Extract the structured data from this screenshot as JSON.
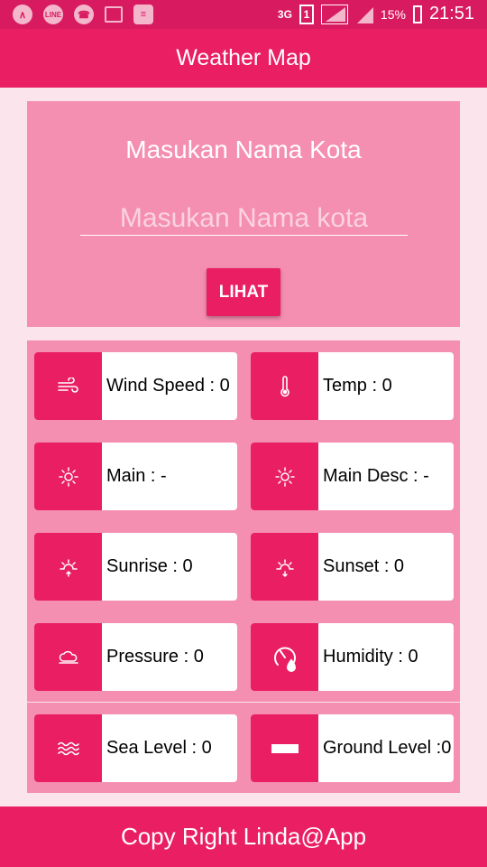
{
  "status_bar": {
    "network": "3G",
    "sim": "1",
    "battery": "15%",
    "time": "21:51",
    "icons": [
      "nav-icon",
      "line-icon",
      "whatsapp-icon",
      "gallery-icon",
      "wifi-icon"
    ]
  },
  "app_bar": {
    "title": "Weather Map"
  },
  "search": {
    "title": "Masukan Nama Kota",
    "placeholder": "Masukan Nama kota",
    "value": "",
    "button_label": "LIHAT"
  },
  "cards": {
    "wind_speed": {
      "label": "Wind Speed : 0",
      "icon": "wind-icon"
    },
    "temp": {
      "label": "Temp : 0",
      "icon": "thermometer-icon"
    },
    "main": {
      "label": "Main : -",
      "icon": "sun-icon"
    },
    "main_desc": {
      "label": "Main Desc : -",
      "icon": "sun-icon"
    },
    "sunrise": {
      "label": "Sunrise : 0",
      "icon": "sunrise-icon"
    },
    "sunset": {
      "label": "Sunset : 0",
      "icon": "sunset-icon"
    },
    "pressure": {
      "label": "Pressure : 0",
      "icon": "cloud-icon"
    },
    "humidity": {
      "label": "Humidity : 0",
      "icon": "humidity-gauge-icon"
    },
    "sea_level": {
      "label": "Sea Level : 0",
      "icon": "waves-icon"
    },
    "ground_level": {
      "label": "Ground Level :0",
      "icon": "ground-icon"
    }
  },
  "footer": {
    "text": "Copy Right Linda@App"
  },
  "colors": {
    "primary": "#e91e63",
    "primary_dark": "#d81b60",
    "card_panel": "#f48fb1",
    "background": "#fce4ec"
  }
}
